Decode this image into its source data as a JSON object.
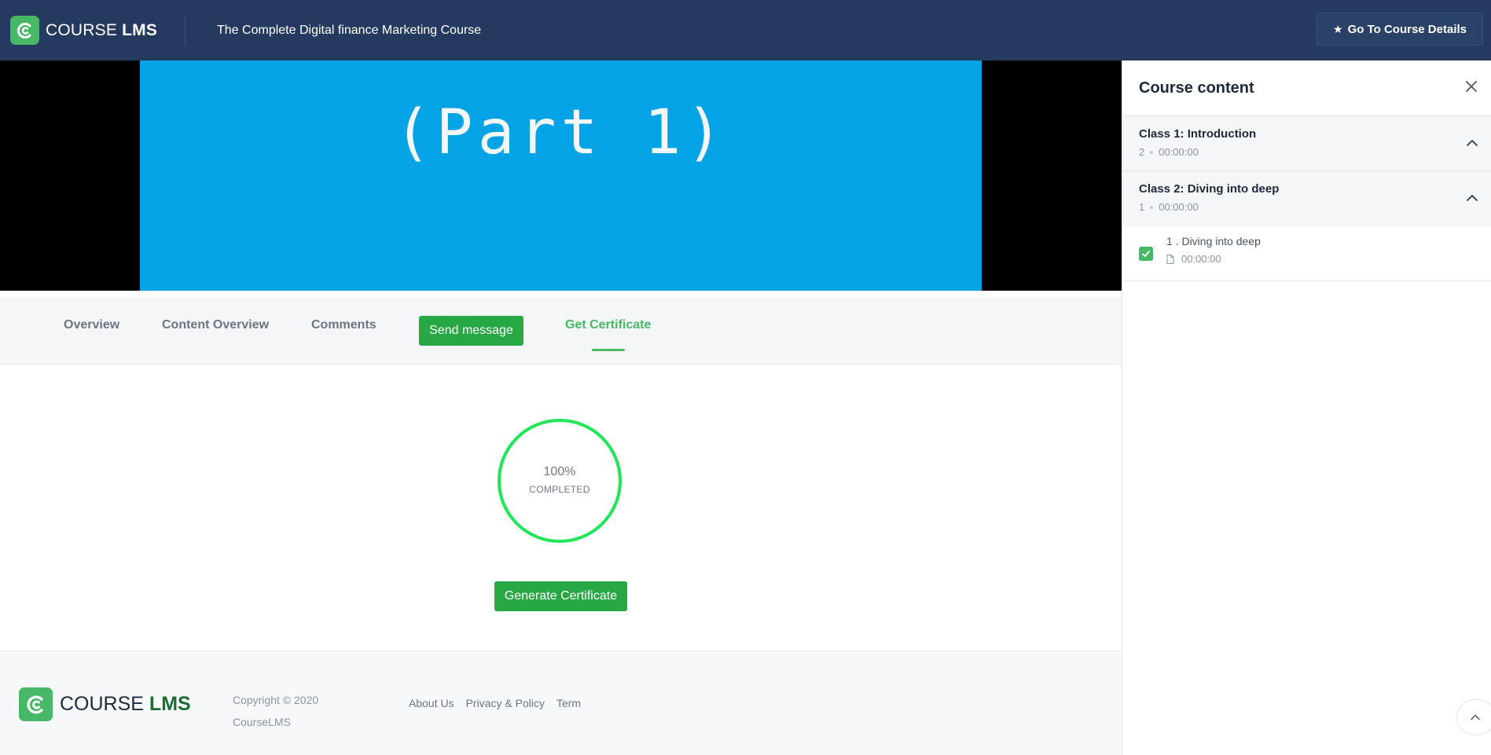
{
  "header": {
    "brand_course": "COURSE",
    "brand_lms": "LMS",
    "course_title": "The Complete Digital finance Marketing Course",
    "details_button": "Go To Course Details",
    "details_icon": "star-icon"
  },
  "video": {
    "caption": "(Part 1)"
  },
  "tabs": [
    {
      "label": "Overview"
    },
    {
      "label": "Content Overview"
    },
    {
      "label": "Comments"
    },
    {
      "label": "Send message"
    },
    {
      "label": "Get Certificate"
    }
  ],
  "active_tab": "Get Certificate",
  "certificate": {
    "percent": "100%",
    "percent_value": 100,
    "status": "COMPLETED",
    "generate_button": "Generate Certificate",
    "ring_color": "#22e55a"
  },
  "footer": {
    "brand_course": "COURSE",
    "brand_lms": "LMS",
    "copyright_line1": "Copyright © 2020",
    "copyright_line2": "CourseLMS",
    "links": [
      "About Us",
      "Privacy & Policy",
      "Term"
    ]
  },
  "sidebar": {
    "title": "Course content",
    "sections": [
      {
        "title": "Class 1: Introduction",
        "count": "2",
        "duration": "00:00:00",
        "expanded": true
      },
      {
        "title": "Class 2: Diving into deep",
        "count": "1",
        "duration": "00:00:00",
        "expanded": true,
        "lessons": [
          {
            "title": "1 . Diving into deep",
            "duration": "00:00:00",
            "completed": true
          }
        ]
      }
    ]
  },
  "colors": {
    "header_bg": "#243a5e",
    "accent_green": "#47b866",
    "button_green": "#28a745",
    "video_bg": "#03a3e6"
  }
}
